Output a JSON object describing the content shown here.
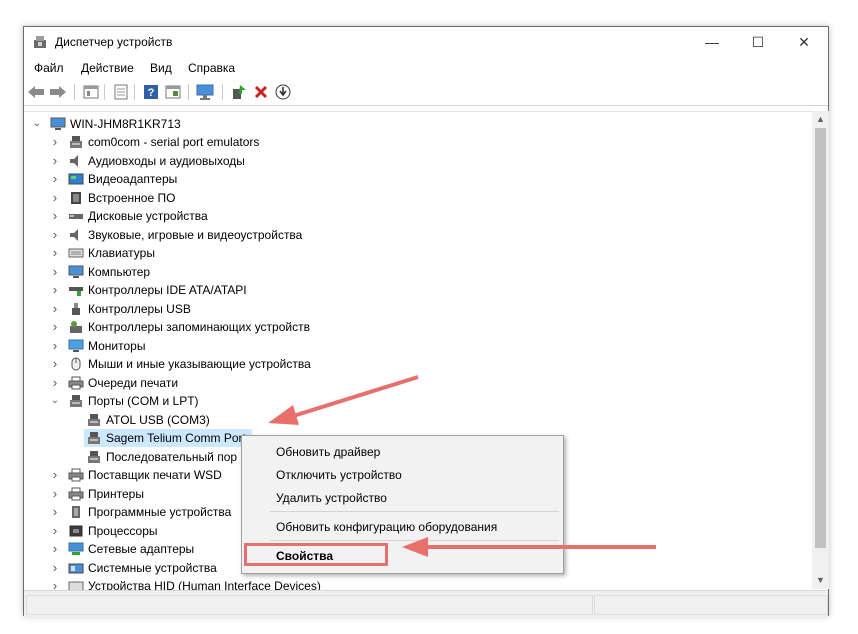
{
  "window": {
    "title": "Диспетчер устройств",
    "controls": {
      "minimize": "—",
      "maximize": "☐",
      "close": "✕"
    }
  },
  "menu": [
    "Файл",
    "Действие",
    "Вид",
    "Справка"
  ],
  "toolbar": {
    "icons": [
      "back-arrow-icon",
      "forward-arrow-icon",
      "show-hidden-icon",
      "properties-icon",
      "help-icon",
      "view-icon",
      "monitor-icon",
      "update-driver-icon",
      "uninstall-icon",
      "download-icon"
    ]
  },
  "tree": {
    "root": "WIN-JHM8R1KR713",
    "items": [
      {
        "label": "com0com - serial port emulators",
        "icon": "port-icon"
      },
      {
        "label": "Аудиовходы и аудиовыходы",
        "icon": "speaker-icon"
      },
      {
        "label": "Видеоадаптеры",
        "icon": "display-adapter-icon"
      },
      {
        "label": "Встроенное ПО",
        "icon": "firmware-icon"
      },
      {
        "label": "Дисковые устройства",
        "icon": "disk-icon"
      },
      {
        "label": "Звуковые, игровые и видеоустройства",
        "icon": "speaker-icon"
      },
      {
        "label": "Клавиатуры",
        "icon": "keyboard-icon"
      },
      {
        "label": "Компьютер",
        "icon": "computer-icon"
      },
      {
        "label": "Контроллеры IDE ATA/ATAPI",
        "icon": "ide-icon"
      },
      {
        "label": "Контроллеры USB",
        "icon": "usb-icon"
      },
      {
        "label": "Контроллеры запоминающих устройств",
        "icon": "storage-controller-icon"
      },
      {
        "label": "Мониторы",
        "icon": "monitor-icon"
      },
      {
        "label": "Мыши и иные указывающие устройства",
        "icon": "mouse-icon"
      },
      {
        "label": "Очереди печати",
        "icon": "printer-icon"
      },
      {
        "label": "Порты (COM и LPT)",
        "icon": "port-icon",
        "expanded": true,
        "children": [
          {
            "label": "ATOL USB (COM3)",
            "icon": "port-icon"
          },
          {
            "label": "Sagem Telium Comm Port",
            "icon": "port-icon",
            "selected": true
          },
          {
            "label": "Последовательный пор",
            "icon": "port-icon"
          }
        ]
      },
      {
        "label": "Поставщик печати WSD",
        "icon": "printer-icon"
      },
      {
        "label": "Принтеры",
        "icon": "printer-icon"
      },
      {
        "label": "Программные устройства",
        "icon": "software-device-icon"
      },
      {
        "label": "Процессоры",
        "icon": "processor-icon"
      },
      {
        "label": "Сетевые адаптеры",
        "icon": "network-icon"
      },
      {
        "label": "Системные устройства",
        "icon": "system-device-icon"
      },
      {
        "label": "Устройства HID (Human Interface Devices)",
        "icon": "hid-icon"
      }
    ]
  },
  "context_menu": {
    "items": [
      "Обновить драйвер",
      "Отключить устройство",
      "Удалить устройство",
      "Обновить конфигурацию оборудования",
      "Свойства"
    ]
  },
  "colors": {
    "selection": "#cce8ff",
    "annotation": "#e8706c"
  }
}
